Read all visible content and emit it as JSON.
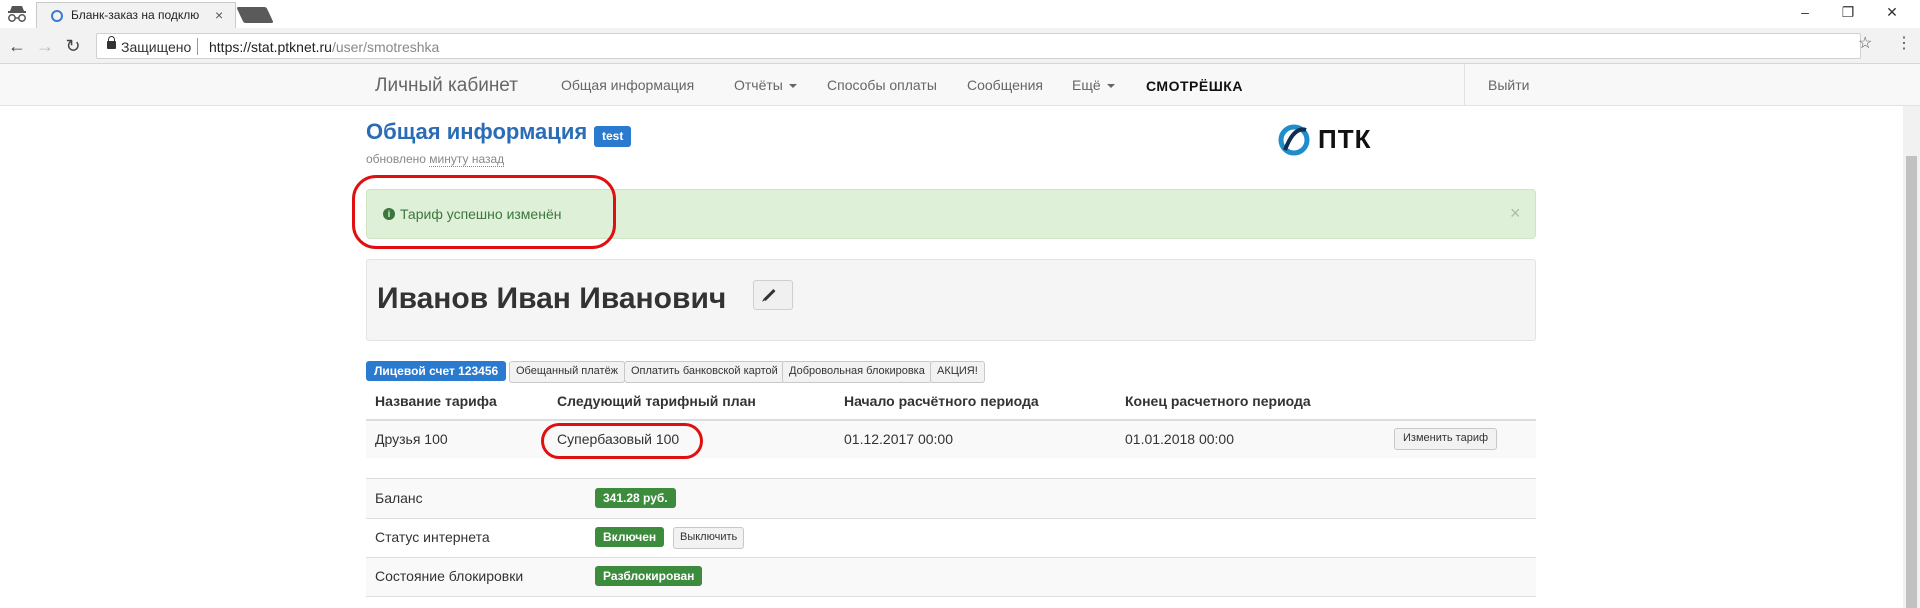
{
  "browser": {
    "tab_title": "Бланк-заказ на подклю",
    "secure_label": "Защищено",
    "url_host": "https://stat.ptknet.ru",
    "url_path": "/user/smotreshka"
  },
  "navbar": {
    "brand": "Личный кабинет",
    "links": [
      "Общая информация",
      "Отчёты",
      "Способы оплаты",
      "Сообщения",
      "Ещё"
    ],
    "partner": "СМОТРЁШКА",
    "logout": "Выйти"
  },
  "header": {
    "title": "Общая информация",
    "badge": "test",
    "updated_prefix": "обновлено",
    "updated_ago": "минуту назад",
    "logo_text": "ПТК"
  },
  "alert": {
    "text": "Тариф успешно изменён",
    "close": "×"
  },
  "user": {
    "fullname": "Иванов Иван Иванович"
  },
  "actions": {
    "account": "Лицевой счет 123456",
    "buttons": [
      "Обещанный платёж",
      "Оплатить банковской картой",
      "Добровольная блокировка",
      "АКЦИЯ!"
    ]
  },
  "tariff_table": {
    "headers": [
      "Название тарифа",
      "Следующий тарифный план",
      "Начало расчётного периода",
      "Конец расчетного периода"
    ],
    "row": [
      "Друзья 100",
      "Супербазовый 100",
      "01.12.2017 00:00",
      "01.01.2018 00:00"
    ],
    "change_button": "Изменить тариф"
  },
  "info": {
    "balance_label": "Баланс",
    "balance_value": "341.28 руб.",
    "internet_label": "Статус интернета",
    "internet_value": "Включен",
    "internet_toggle": "Выключить",
    "block_label": "Состояние блокировки",
    "block_value": "Разблокирован"
  },
  "colors": {
    "link_blue": "#2a6cb5",
    "label_primary": "#2a7ad0",
    "success_green": "#3d8b3d",
    "alert_bg": "#dff0d8",
    "annotation_red": "#e01010"
  }
}
